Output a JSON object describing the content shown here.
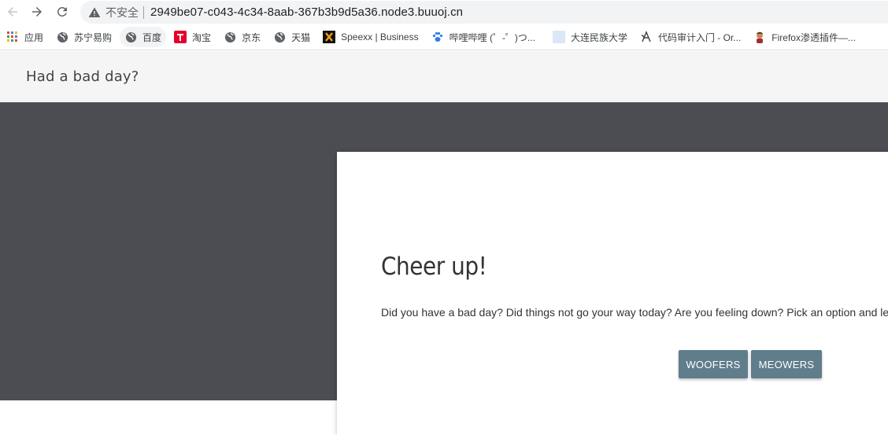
{
  "browser": {
    "security_label": "不安全",
    "url": "2949be07-c043-4c34-8aab-367b3b9d5a36.node3.buuoj.cn"
  },
  "bookmarks": [
    {
      "label": "应用",
      "icon": "apps-grid-icon"
    },
    {
      "label": "苏宁易购",
      "icon": "globe-icon"
    },
    {
      "label": "百度",
      "icon": "globe-icon"
    },
    {
      "label": "淘宝",
      "icon": "taobao-icon"
    },
    {
      "label": "京东",
      "icon": "globe-icon"
    },
    {
      "label": "天猫",
      "icon": "globe-icon"
    },
    {
      "label": "Speexx | Business",
      "icon": "speexx-icon"
    },
    {
      "label": "哔哩哔哩 (゜-゜)つ...",
      "icon": "paw-icon"
    },
    {
      "label": "大连民族大学",
      "icon": "blank-page-icon"
    },
    {
      "label": "代码审计入门 - Or...",
      "icon": "wing-icon"
    },
    {
      "label": "Firefox渗透插件—...",
      "icon": "avatar-icon"
    }
  ],
  "page": {
    "brand": "Had a bad day?",
    "card": {
      "title": "Cheer up!",
      "text": "Did you have a bad day? Did things not go your way today? Are you feeling down? Pick an option and le",
      "buttons": {
        "woofers": "WOOFERS",
        "meowers": "MEOWERS"
      }
    }
  },
  "colors": {
    "hero_bg": "#4b4d52",
    "header_bg": "#f5f5f5",
    "button_bg": "#607d8b"
  }
}
